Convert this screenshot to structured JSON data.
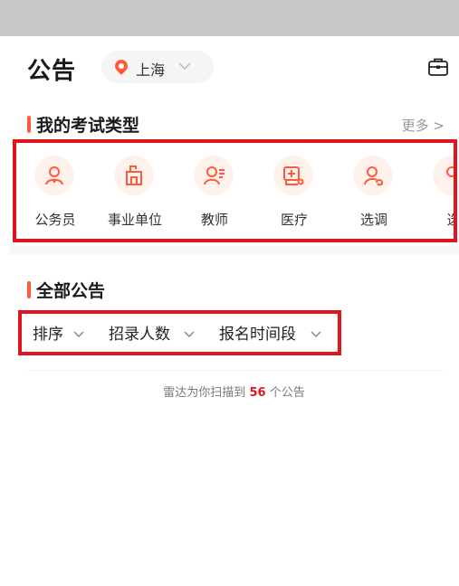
{
  "header": {
    "title": "公告",
    "city": "上海",
    "icons": {
      "location": "location-pin-icon",
      "dropdown": "chevron-down-icon",
      "briefcase": "briefcase-icon"
    }
  },
  "exam_section": {
    "title": "我的考试类型",
    "more": "更多 >",
    "items": [
      {
        "label": "公务员",
        "icon": "civil-servant-icon"
      },
      {
        "label": "事业单位",
        "icon": "institution-building-icon"
      },
      {
        "label": "教师",
        "icon": "teacher-icon"
      },
      {
        "label": "医疗",
        "icon": "medical-icon"
      },
      {
        "label": "选调",
        "icon": "transfer-icon"
      },
      {
        "label": "选",
        "icon": "partial-item-icon"
      }
    ]
  },
  "announcements": {
    "title": "全部公告",
    "filters": [
      {
        "label": "排序"
      },
      {
        "label": "招录人数"
      },
      {
        "label": "报名时间段"
      }
    ],
    "radar_prefix": "雷达为你扫描到",
    "radar_count": "56",
    "radar_suffix": "个公告"
  },
  "colors": {
    "accent": "#ff5a3c",
    "highlight_border": "#e0151e",
    "status_bar": "#c8c8c8",
    "icon_bg": "#fff1ec"
  }
}
